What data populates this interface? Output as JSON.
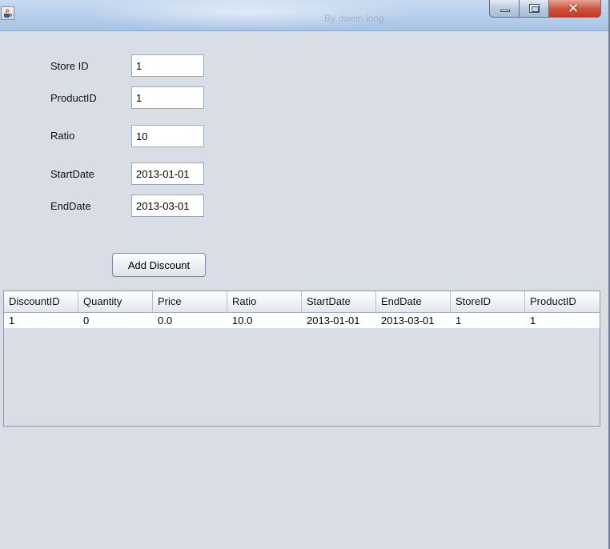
{
  "window": {
    "title": "By dwein long"
  },
  "form": {
    "store_id": {
      "label": "Store ID",
      "value": "1"
    },
    "product_id": {
      "label": "ProductID",
      "value": "1"
    },
    "ratio": {
      "label": "Ratio",
      "value": "10"
    },
    "start_date": {
      "label": "StartDate",
      "value": "2013-01-01"
    },
    "end_date": {
      "label": "EndDate",
      "value": "2013-03-01"
    },
    "add_button_label": "Add Discount"
  },
  "table": {
    "columns": [
      "DiscountID",
      "Quantity",
      "Price",
      "Ratio",
      "StartDate",
      "EndDate",
      "StoreID",
      "ProductID"
    ],
    "rows": [
      [
        "1",
        "0",
        "0.0",
        "10.0",
        "2013-01-01",
        "2013-03-01",
        "1",
        "1"
      ]
    ]
  },
  "icons": {
    "app": "java-cup-icon",
    "minimize": "minimize-icon",
    "maximize": "maximize-icon",
    "close": "close-icon"
  },
  "colors": {
    "window_bg": "#d9dde5",
    "titlebar": "#b9d0ec",
    "close_button": "#c84a32"
  }
}
